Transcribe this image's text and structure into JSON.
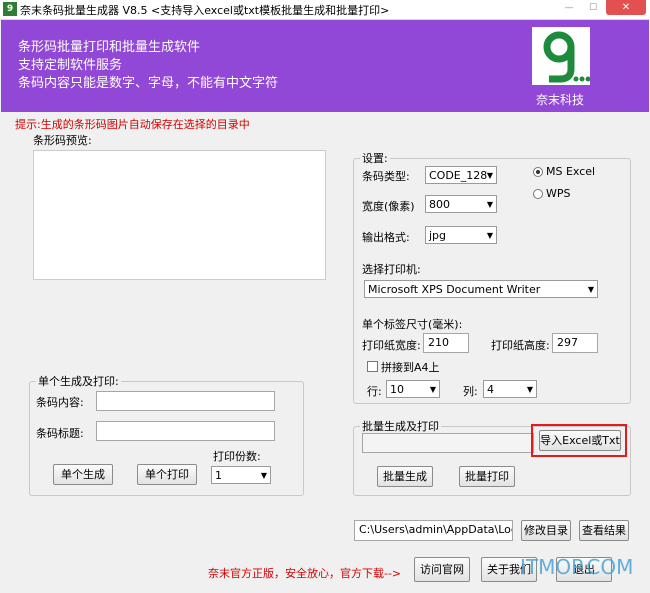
{
  "window": {
    "title": "奈末条码批量生成器 V8.5    <支持导入excel或txt模板批量生成和批量打印>"
  },
  "banner": {
    "line1": "条形码批量打印和批量生成软件",
    "line2": "支持定制软件服务",
    "line3": "条码内容只能是数字、字母，不能有中文字符",
    "logo_text": "奈末科技",
    "bg_color": "#9248d6"
  },
  "hint": "提示:生成的条形码图片自动保存在选择的目录中",
  "preview_label": "条形码预览:",
  "settings": {
    "legend": "设置:",
    "barcode_type_label": "条码类型:",
    "barcode_type_value": "CODE_128",
    "width_label": "宽度(像素)",
    "width_value": "800",
    "output_label": "输出格式:",
    "output_value": "jpg",
    "radio_ms_excel": "MS  Excel",
    "radio_wps": "WPS",
    "printer_label": "选择打印机:",
    "printer_value": "Microsoft XPS Document Writer",
    "label_size_label": "单个标签尺寸(毫米):",
    "paper_width_label": "打印纸宽度:",
    "paper_width_value": "210",
    "paper_height_label": "打印纸高度:",
    "paper_height_value": "297",
    "tile_a4_label": "拼接到A4上",
    "rows_label": "行:",
    "rows_value": "10",
    "cols_label": "列:",
    "cols_value": "4"
  },
  "single": {
    "legend": "单个生成及打印:",
    "content_label": "条码内容:",
    "title_label": "条码标题:",
    "copies_label": "打印份数:",
    "copies_value": "1",
    "generate_btn": "单个生成",
    "print_btn": "单个打印"
  },
  "batch": {
    "legend": "批量生成及打印",
    "import_btn": "导入Excel或Txt",
    "generate_btn": "批量生成",
    "print_btn": "批量打印"
  },
  "path": {
    "value": "C:\\Users\\admin\\AppData\\Local\\Te",
    "change_btn": "修改目录",
    "view_btn": "查看结果"
  },
  "footer": {
    "promo": "奈末官方正版，安全放心，官方下载-->",
    "website_btn": "访问官网",
    "about_btn": "关于我们",
    "exit_btn": "退出"
  },
  "watermark": "ITMOP.COM"
}
